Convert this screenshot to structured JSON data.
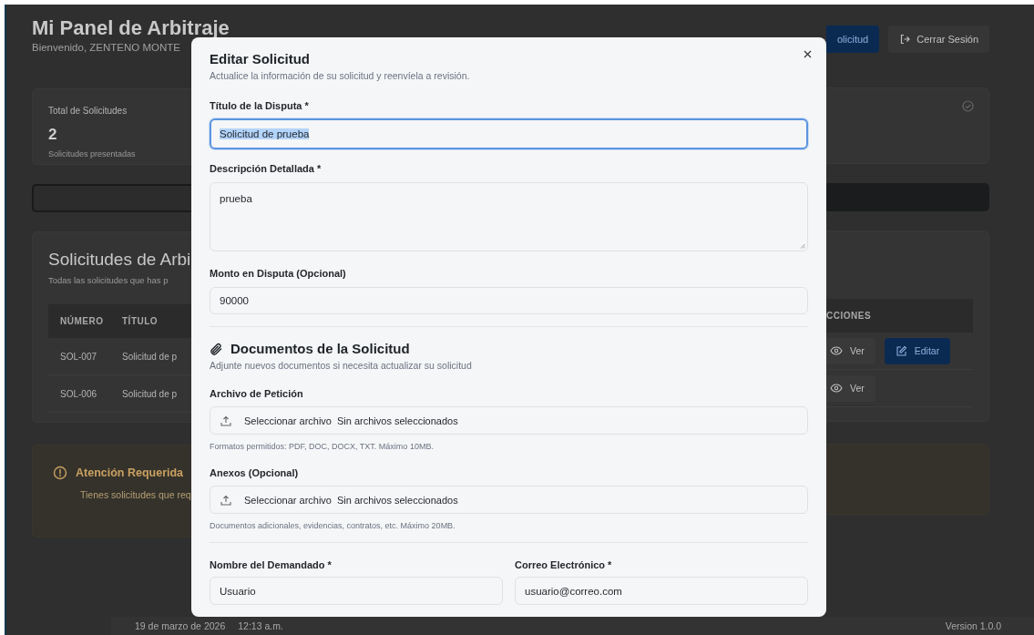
{
  "header": {
    "title": "Mi Panel de Arbitraje",
    "welcome": "Bienvenido, ZENTENO MONTE",
    "buttons": [
      {
        "kind": "primary",
        "label": "olicitud"
      },
      {
        "kind": "logout",
        "label": "Cerrar Sesión"
      }
    ]
  },
  "stat_card": {
    "label": "Total de Solicitudes",
    "value": "2",
    "caption": "Solicitudes presentadas"
  },
  "requests": {
    "title": "Solicitudes de Arbi",
    "subtitle": "Todas las solicitudes que has p",
    "columns": [
      "NÚMERO",
      "TÍTULO",
      "CCIONES"
    ],
    "rows": [
      {
        "number": "SOL-007",
        "title": "Solicitud de p",
        "actions": [
          {
            "kind": "view",
            "label": "Ver"
          },
          {
            "kind": "edit",
            "label": "Editar"
          }
        ]
      },
      {
        "number": "SOL-006",
        "title": "Solicitud de p",
        "actions": [
          {
            "kind": "view",
            "label": "Ver"
          }
        ]
      }
    ]
  },
  "alert": {
    "title": "Atención Requerida",
    "text": "Tienes solicitudes que req"
  },
  "footer": {
    "date": "19 de marzo de 2026",
    "time": "12:13 a.m.",
    "version": "Version 1.0.0"
  },
  "dialog": {
    "title": "Editar Solicitud",
    "subtitle": "Actualice la información de su solicitud y reenvíela a revisión.",
    "fields": [
      {
        "kind": "text",
        "label": "Título de la Disputa *",
        "value": "Solicitud de prueba",
        "focused": true
      },
      {
        "kind": "textarea",
        "label": "Descripción Detallada *",
        "value": "prueba",
        "focused": false
      },
      {
        "kind": "text",
        "label": "Monto en Disputa (Opcional)",
        "value": "90000",
        "focused": false
      }
    ],
    "documents": {
      "title": "Documentos de la Solicitud",
      "subtitle": "Adjunte nuevos documentos si necesita actualizar su solicitud",
      "uploads": [
        {
          "label": "Archivo de Petición",
          "button": "Seleccionar archivo",
          "status": "Sin archivos seleccionados",
          "hint": "Formatos permitidos: PDF, DOC, DOCX, TXT. Máximo 10MB."
        },
        {
          "label": "Anexos (Opcional)",
          "button": "Seleccionar archivo",
          "status": "Sin archivos seleccionados",
          "hint": "Documentos adicionales, evidencias, contratos, etc. Máximo 20MB."
        }
      ]
    },
    "respondent_fields": [
      {
        "kind": "text",
        "label": "Nombre del Demandado *",
        "value": "Usuario",
        "focused": false
      },
      {
        "kind": "text",
        "label": "Correo Electrónico *",
        "value": "usuario@correo.com",
        "focused": false
      }
    ]
  }
}
